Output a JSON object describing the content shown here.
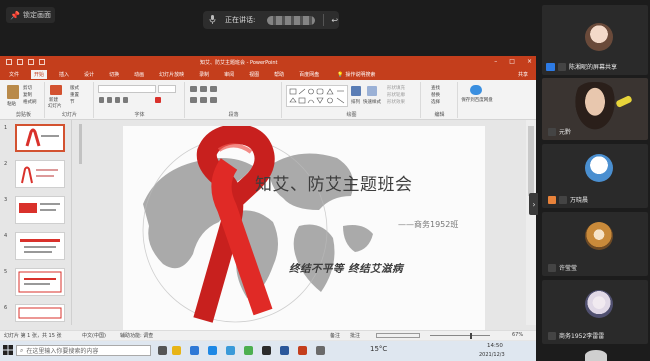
{
  "meeting": {
    "lock_label": "锁定画面",
    "speaking_label": "正在讲话:"
  },
  "ppt": {
    "title": "知艾、防艾主题班会 - PowerPoint",
    "tabs": [
      "文件",
      "开始",
      "插入",
      "设计",
      "切换",
      "动画",
      "幻灯片放映",
      "录制",
      "审阅",
      "视图",
      "帮助",
      "百度网盘"
    ],
    "active_tab": "开始",
    "tell_me": "操作说明搜索",
    "share": "共享",
    "ribbon_groups": [
      "剪贴板",
      "幻灯片",
      "字体",
      "段落",
      "绘图",
      "编辑",
      "保存"
    ],
    "clipboard_items": [
      "粘贴",
      "剪切",
      "复制",
      "格式刷"
    ],
    "slides_items": [
      "新建",
      "幻灯片",
      "版式",
      "重置",
      "节"
    ],
    "drawing_items": [
      "排列",
      "快速样式",
      "形状填充",
      "形状轮廓",
      "形状效果"
    ],
    "editing_items": [
      "查找",
      "替换",
      "选择"
    ],
    "save_item": "保存到百度网盘",
    "thumb_numbers": [
      "1",
      "2",
      "3",
      "4",
      "5",
      "6"
    ],
    "slide": {
      "title": "知艾、防艾主题班会",
      "subtitle": "——商务1952班",
      "slogan": "终结不平等  终结艾滋病"
    },
    "status": {
      "left": "幻灯片 第 1 张，共 15 张",
      "lang": "中文(中国)",
      "accessibility": "辅助功能: 调查",
      "notes": "备注",
      "comments": "批注",
      "zoom": "67%"
    }
  },
  "taskbar": {
    "search_placeholder": "在这里输入你要搜索的内容",
    "weather": "15°C",
    "time": "14:50",
    "date": "2021/12/3"
  },
  "participants": [
    {
      "name": "陈湘昵的屏幕共享"
    },
    {
      "name": "元黔"
    },
    {
      "name": "万晓晨"
    },
    {
      "name": "许莹莹"
    },
    {
      "name": "商务1952李雷雷"
    }
  ],
  "colors": {
    "ppt_accent": "#c43e1c",
    "ribbon_red": "#d9312b"
  }
}
